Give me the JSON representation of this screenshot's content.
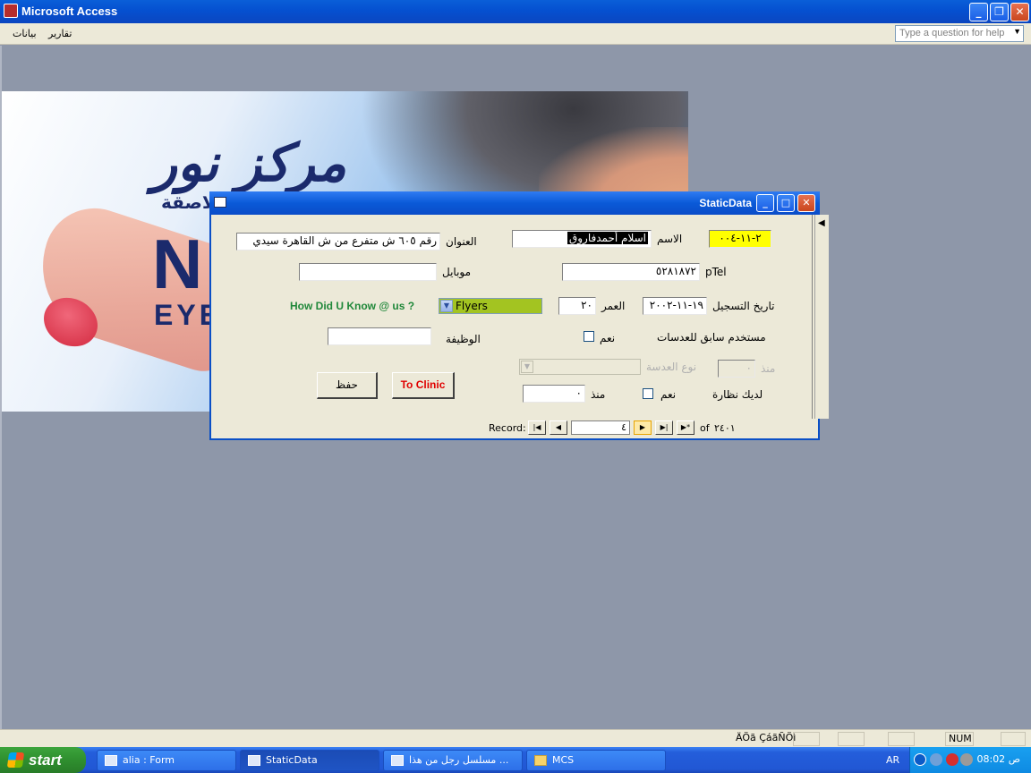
{
  "app": {
    "title": "Microsoft Access"
  },
  "menu": {
    "items": [
      "تقارير",
      "بيانات"
    ],
    "help_placeholder": "Type a question for help"
  },
  "form": {
    "title": "StaticData",
    "code_value": "٢-١١-٠٠٤",
    "name_label": "الاسم",
    "name_value": "اسلام أحمدفاروق",
    "address_label": "العنوان",
    "address_value": "رقم ٦٠٥ ش متفرع من ش القاهرة سيدي",
    "ptel_label": "pTel",
    "ptel_value": "٥٢٨١٨٧٢",
    "mobile_label": "موبايل",
    "mobile_value": "",
    "reg_date_label": "تاريخ التسجيل",
    "reg_date_value": "١٩-١١-٢٠٠٢",
    "age_label": "العمر",
    "age_value": "٢٠",
    "how_label": "How Did U Know @ us ?",
    "how_value": "Flyers",
    "prev_lens_label": "مستخدم سابق للعدسات",
    "yes_label": "نعم",
    "job_label": "الوظيفة",
    "job_value": "",
    "since_label": "منذ",
    "since_value": "٠",
    "lens_type_label": "نوع العدسة",
    "glasses_label": "لديك نظارة",
    "glasses_yes_label": "نعم",
    "glasses_since_label": "منذ",
    "glasses_since_value": "٠",
    "save_label": "حفظ",
    "clinic_label": "To Clinic"
  },
  "navigator": {
    "record_label": "Record:",
    "current": "٤",
    "of_label": "of",
    "total": "٢٤٠١"
  },
  "status": {
    "text": "ÄÖã ÇáãÑÖì",
    "num": "NUM"
  },
  "taskbar": {
    "start_label": "start",
    "tasks": [
      "alia : Form",
      "StaticData",
      "مسلسل رجل من هذا ...",
      "MCS"
    ],
    "lang": "AR",
    "clock": "08:02 ص"
  }
}
